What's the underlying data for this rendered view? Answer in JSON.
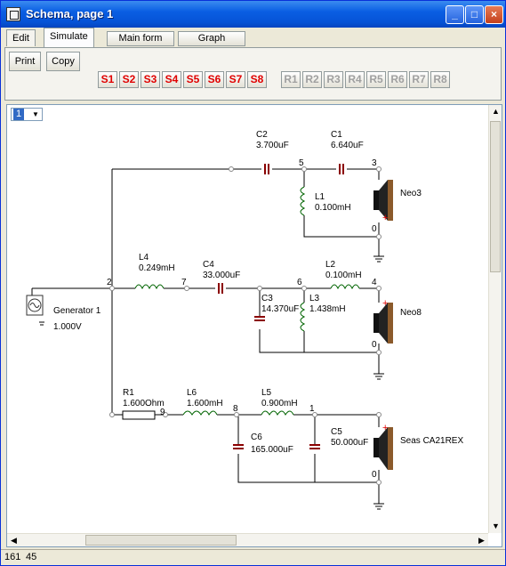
{
  "window": {
    "title": "Schema, page 1"
  },
  "titlebar_buttons": {
    "minimize": "_",
    "maximize": "□",
    "close": "×"
  },
  "menu": {
    "tabs": [
      "Edit",
      "Simulate"
    ],
    "active_tab": "Simulate",
    "main_form": "Main form",
    "graph": "Graph"
  },
  "toolbar": {
    "print": "Print",
    "copy": "Copy",
    "s_buttons": [
      "S1",
      "S2",
      "S3",
      "S4",
      "S5",
      "S6",
      "S7",
      "S8"
    ],
    "r_buttons": [
      "R1",
      "R2",
      "R3",
      "R4",
      "R5",
      "R6",
      "R7",
      "R8"
    ]
  },
  "page_select": {
    "value": "1"
  },
  "schematic": {
    "components": {
      "c2": {
        "name": "C2",
        "value": "3.700uF"
      },
      "c1": {
        "name": "C1",
        "value": "6.640uF"
      },
      "l1": {
        "name": "L1",
        "value": "0.100mH"
      },
      "l4": {
        "name": "L4",
        "value": "0.249mH"
      },
      "c4": {
        "name": "C4",
        "value": "33.000uF"
      },
      "l2": {
        "name": "L2",
        "value": "0.100mH"
      },
      "c3": {
        "name": "C3",
        "value": "14.370uF"
      },
      "l3": {
        "name": "L3",
        "value": "1.438mH"
      },
      "gen": {
        "name": "Generator 1",
        "value": "1.000V"
      },
      "r1": {
        "name": "R1",
        "value": "1.600Ohm"
      },
      "l6": {
        "name": "L6",
        "value": "1.600mH"
      },
      "l5": {
        "name": "L5",
        "value": "0.900mH"
      },
      "c6": {
        "name": "C6",
        "value": "165.000uF"
      },
      "c5": {
        "name": "C5",
        "value": "50.000uF"
      }
    },
    "speakers": [
      "Neo3",
      "Neo8",
      "Seas CA21REX"
    ],
    "nodes": {
      "n2": "2",
      "n7": "7",
      "n6": "6",
      "n5": "5",
      "n3": "3",
      "n0a": "0",
      "n4": "4",
      "n0b": "0",
      "n9": "9",
      "n8": "8",
      "n1": "1",
      "n0c": "0"
    }
  },
  "status": {
    "x": "161",
    "y": "45"
  }
}
